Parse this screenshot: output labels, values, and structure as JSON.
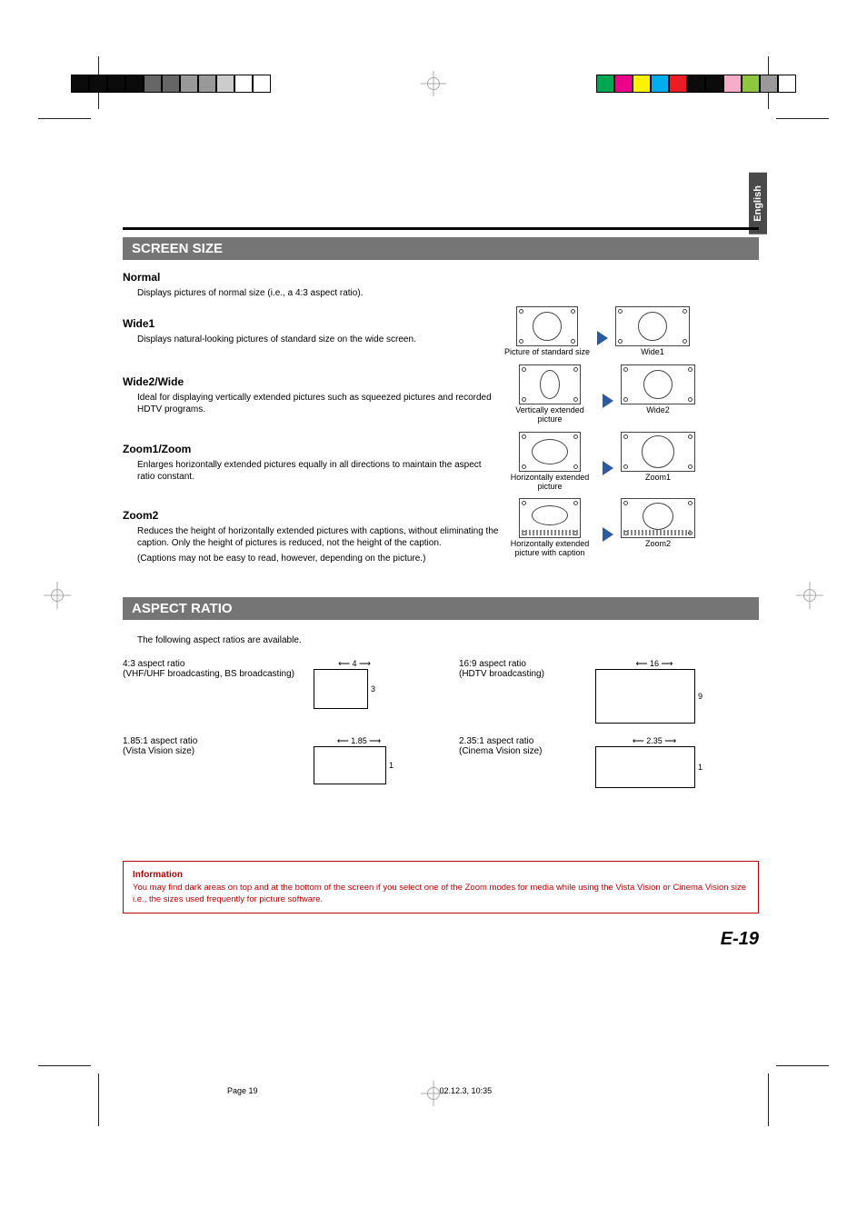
{
  "language_tab": "English",
  "sections": {
    "screen_size": {
      "title": "SCREEN SIZE",
      "normal": {
        "heading": "Normal",
        "text": "Displays pictures of normal size (i.e., a 4:3 aspect ratio)."
      },
      "wide1": {
        "heading": "Wide1",
        "text": "Displays natural-looking pictures of standard size on the wide screen.",
        "src_label": "Picture of standard size",
        "dst_label": "Wide1"
      },
      "wide2": {
        "heading": "Wide2/Wide",
        "text": "Ideal for displaying vertically extended pictures such as squeezed pictures and recorded HDTV programs.",
        "src_label": "Vertically extended picture",
        "dst_label": "Wide2"
      },
      "zoom1": {
        "heading": "Zoom1/Zoom",
        "text": "Enlarges horizontally extended pictures equally in all directions to maintain the aspect ratio constant.",
        "src_label": "Horizontally extended picture",
        "dst_label": "Zoom1"
      },
      "zoom2": {
        "heading": "Zoom2",
        "text1": "Reduces the height of horizontally extended pictures with captions, without eliminating the caption.  Only the height of pictures is reduced, not the height of the caption.",
        "text2": "(Captions may not be easy to read, however, depending on the picture.)",
        "src_label": "Horizontally extended picture with caption",
        "dst_label": "Zoom2"
      }
    },
    "aspect_ratio": {
      "title": "ASPECT RATIO",
      "intro": "The following aspect ratios are available.",
      "items": [
        {
          "label": "4:3 aspect ratio",
          "sublabel": "(VHF/UHF broadcasting, BS broadcasting)",
          "w": "4",
          "h": "3"
        },
        {
          "label": "16:9 aspect ratio",
          "sublabel": "(HDTV broadcasting)",
          "w": "16",
          "h": "9"
        },
        {
          "label": "1.85:1 aspect ratio",
          "sublabel": "(Vista Vision size)",
          "w": "1.85",
          "h": "1"
        },
        {
          "label": "2.35:1 aspect ratio",
          "sublabel": "(Cinema Vision size)",
          "w": "2.35",
          "h": "1"
        }
      ]
    }
  },
  "info": {
    "heading": "Information",
    "text": "You may find dark areas on top and at the bottom of the screen if you select one of the Zoom modes for media while using the Vista Vision or Cinema Vision size i.e., the sizes used frequently for picture software."
  },
  "page_number": "E-19",
  "footer": {
    "page": "Page 19",
    "timestamp": "02.12.3, 10:35"
  },
  "colors": {
    "reg_left": [
      "#0b0b0b",
      "#0b0b0b",
      "#0b0b0b",
      "#0b0b0b",
      "#666",
      "#666",
      "#999",
      "#999",
      "#ccc",
      "#fff",
      "#fff"
    ],
    "reg_right": [
      "#00a651",
      "#ec008c",
      "#fff200",
      "#00aeef",
      "#ed1c24",
      "#0b0b0b",
      "#0b0b0b",
      "#f7adc9",
      "#8dc63f",
      "#999",
      "#fff"
    ]
  }
}
